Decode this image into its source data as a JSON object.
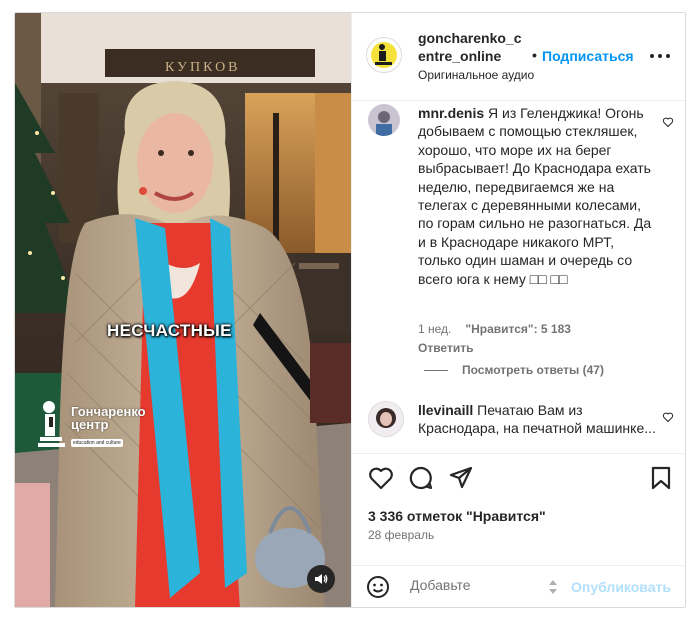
{
  "post": {
    "username": "goncharenko_c entre_online",
    "follow_label": "Подписаться",
    "separator": "•",
    "audio_label": "Оригинальное аудио",
    "overlay_caption": "НЕСЧАСТНЫЕ",
    "brand_name_line1": "Гончаренко",
    "brand_name_line2": "центр",
    "brand_tagline": "education and culture"
  },
  "comments": [
    {
      "username": "mnr.denis",
      "text": "Я из Геленджика! Огонь добываем с помощью стекляшек, хорошо, что море их на берег выбрасывает! До Краснодара ехать неделю, передвигаемся же на телегах с деревянными колесами, по горам сильно не разогнаться. Да и в Краснодаре никакого МРТ, только один шаман и очередь со всего юга к нему",
      "trailing_glyphs": "□□ □□",
      "time": "1 нед.",
      "likes": "\"Нравится\": 5 183",
      "reply_label": "Ответить"
    },
    {
      "username": "llevinaill",
      "text": "Печатаю Вам из Краснодара, на печатной машинке..."
    }
  ],
  "view_replies_label": "Посмотреть ответы (47)",
  "likes_total": "3 336 отметок \"Нравится\"",
  "date": "28 февраль",
  "composer": {
    "placeholder": "Добавьте",
    "publish_label": "Опубликовать"
  },
  "colors": {
    "accent": "#0095f6",
    "publish_disabled": "#b2dffc",
    "muted": "#737373",
    "scarf": "#2bb3d9",
    "dress": "#e63a2f",
    "coat": "#b9a58d"
  }
}
